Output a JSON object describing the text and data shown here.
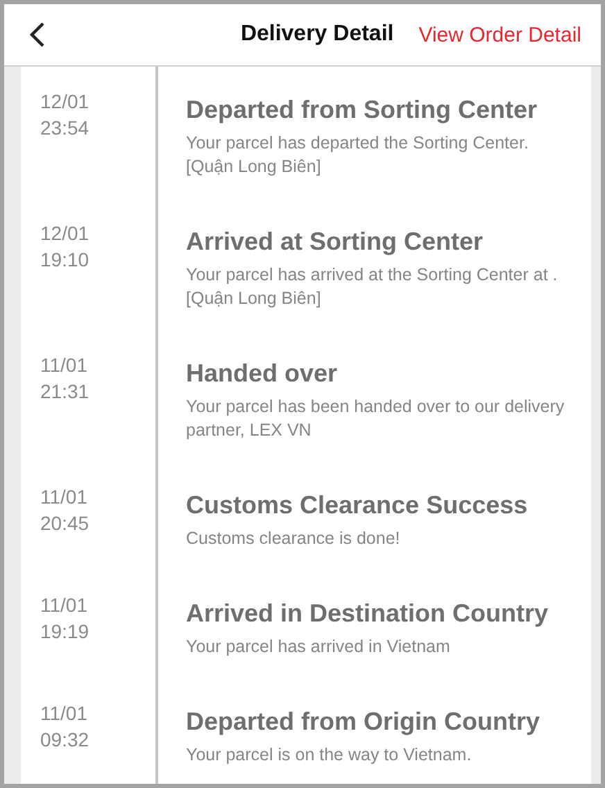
{
  "header": {
    "title": "Delivery Detail",
    "link": "View Order Detail"
  },
  "events": [
    {
      "date": "12/01",
      "time": "23:54",
      "title": "Departed from Sorting Center",
      "description": "Your parcel has departed the Sorting Center. [Quận Long Biên]"
    },
    {
      "date": "12/01",
      "time": "19:10",
      "title": "Arrived at Sorting Center",
      "description": "Your parcel has arrived at the Sorting Center at .  [Quận Long Biên]"
    },
    {
      "date": "11/01",
      "time": "21:31",
      "title": "Handed over",
      "description": "Your parcel has been handed over to our delivery partner, LEX VN"
    },
    {
      "date": "11/01",
      "time": "20:45",
      "title": "Customs Clearance Success",
      "description": "Customs clearance is done!"
    },
    {
      "date": "11/01",
      "time": "19:19",
      "title": "Arrived in Destination Country",
      "description": "Your parcel has arrived in Vietnam"
    },
    {
      "date": "11/01",
      "time": "09:32",
      "title": "Departed from Origin Country",
      "description": "Your parcel is on the way to Vietnam."
    }
  ]
}
